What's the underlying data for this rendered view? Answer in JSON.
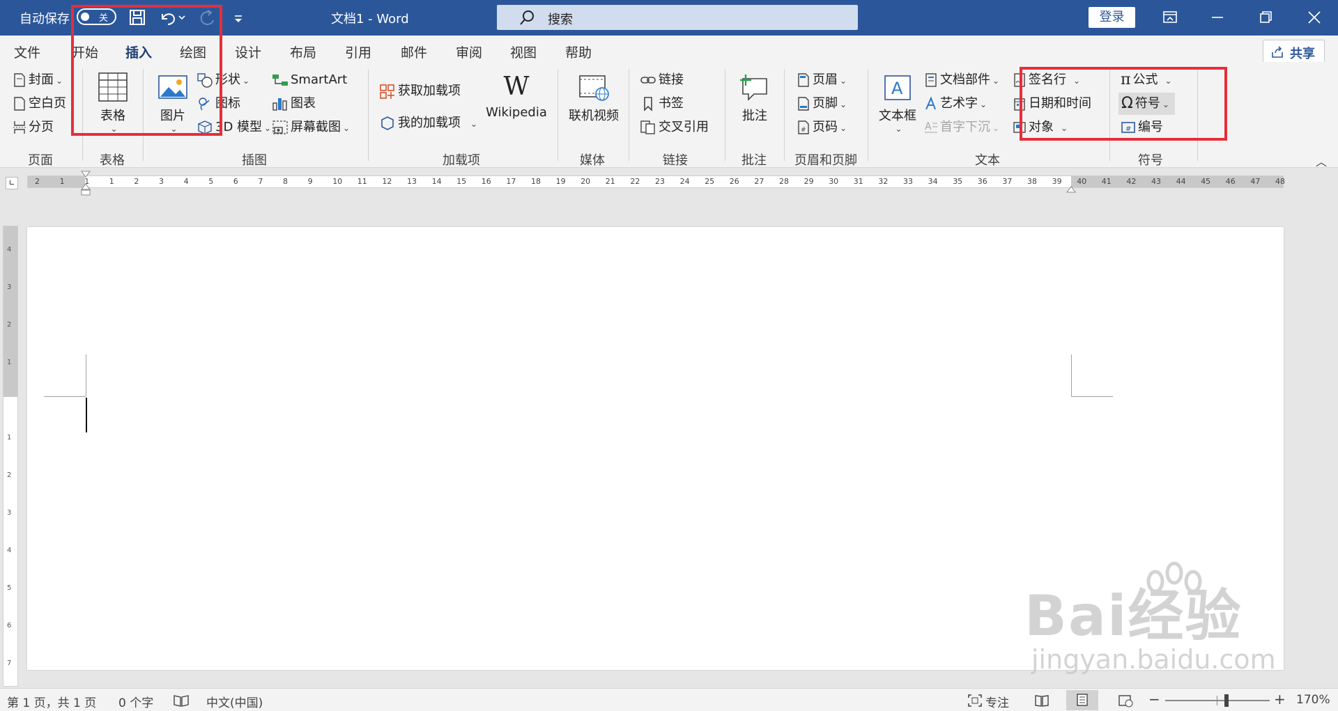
{
  "titlebar": {
    "autosave_label": "自动保存",
    "autosave_state": "关",
    "doc_title": "文档1  -  Word",
    "search_placeholder": "搜索",
    "login": "登录"
  },
  "tabs": [
    {
      "label": "文件"
    },
    {
      "label": "开始"
    },
    {
      "label": "插入",
      "active": true
    },
    {
      "label": "绘图"
    },
    {
      "label": "设计"
    },
    {
      "label": "布局"
    },
    {
      "label": "引用"
    },
    {
      "label": "邮件"
    },
    {
      "label": "审阅"
    },
    {
      "label": "视图"
    },
    {
      "label": "帮助"
    }
  ],
  "share": "共享",
  "ribbon": {
    "pages": {
      "cover": "封面",
      "blank": "空白页",
      "break": "分页",
      "group": "页面"
    },
    "tables": {
      "table": "表格",
      "group": "表格"
    },
    "illustrations": {
      "picture": "图片",
      "shapes": "形状",
      "icons": "图标",
      "model3d": "3D 模型",
      "smartart": "SmartArt",
      "chart": "图表",
      "screenshot": "屏幕截图",
      "group": "插图"
    },
    "addins": {
      "get": "获取加载项",
      "mine": "我的加载项",
      "wikipedia": "Wikipedia",
      "group": "加载项"
    },
    "media": {
      "online_video": "联机视频",
      "group": "媒体"
    },
    "links": {
      "link": "链接",
      "bookmark": "书签",
      "crossref": "交叉引用",
      "group": "链接"
    },
    "comments": {
      "comment": "批注",
      "group": "批注"
    },
    "headerfooter": {
      "header": "页眉",
      "footer": "页脚",
      "pagenum": "页码",
      "group": "页眉和页脚"
    },
    "text": {
      "textbox": "文本框",
      "quickparts": "文档部件",
      "wordart": "艺术字",
      "dropcap": "首字下沉",
      "signature": "签名行",
      "datetime": "日期和时间",
      "object": "对象",
      "group": "文本"
    },
    "symbols": {
      "equation": "公式",
      "symbol": "符号",
      "number": "编号",
      "group": "符号"
    }
  },
  "ruler_numbers": [
    "2",
    "1",
    "1",
    "1",
    "2",
    "3",
    "4",
    "5",
    "6",
    "7",
    "8",
    "9",
    "10",
    "11",
    "12",
    "13",
    "14",
    "15",
    "16",
    "17",
    "18",
    "19",
    "20",
    "21",
    "22",
    "23",
    "24",
    "25",
    "26",
    "27",
    "28",
    "29",
    "30",
    "31",
    "32",
    "33",
    "34",
    "35",
    "36",
    "37",
    "38",
    "39",
    "40",
    "41",
    "42",
    "43",
    "44",
    "45",
    "46",
    "47",
    "48"
  ],
  "status": {
    "page": "第 1 页，共 1 页",
    "words": "0 个字",
    "lang": "中文(中国)",
    "focus": "专注",
    "zoom": "170%"
  },
  "watermark": {
    "brand": "Bai经验",
    "url": "jingyan.baidu.com"
  },
  "colors": {
    "brand": "#2b579a",
    "highlight": "#e62e3a"
  }
}
